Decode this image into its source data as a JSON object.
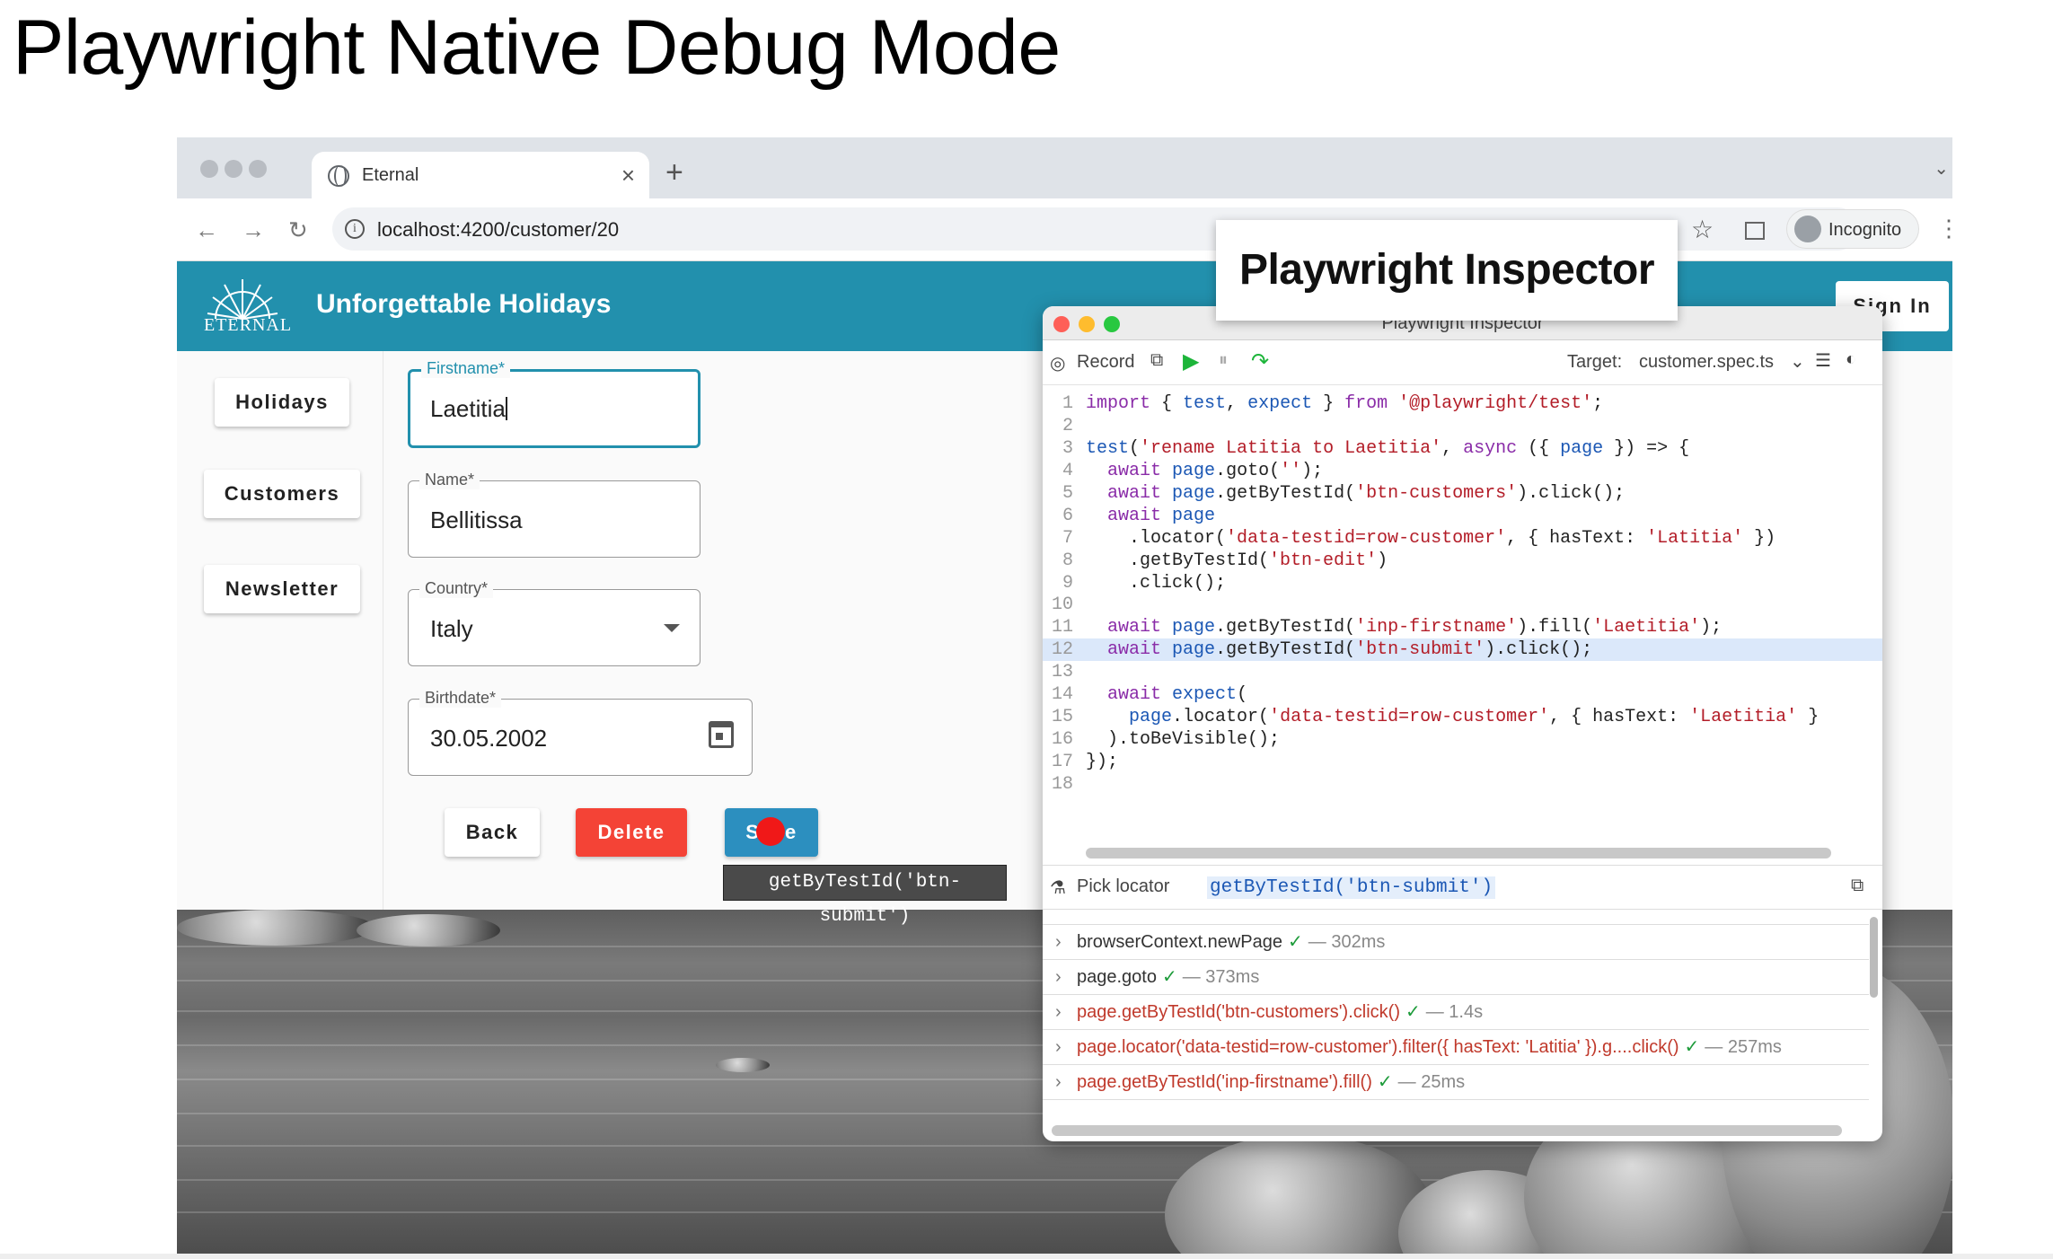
{
  "slide": {
    "title": "Playwright Native Debug Mode"
  },
  "browser": {
    "tab_title": "Eternal",
    "url": "localhost:4200/customer/20",
    "profile_label": "Incognito"
  },
  "app": {
    "logo_text": "ETERNAL",
    "title": "Unforgettable Holidays",
    "sign_in": "Sign In",
    "nav": [
      "Holidays",
      "Customers",
      "Newsletter"
    ],
    "form": {
      "firstname": {
        "label": "Firstname*",
        "value": "Laetitia"
      },
      "name": {
        "label": "Name*",
        "value": "Bellitissa"
      },
      "country": {
        "label": "Country*",
        "value": "Italy"
      },
      "birthdate": {
        "label": "Birthdate*",
        "value": "30.05.2002"
      }
    },
    "buttons": {
      "back": "Back",
      "delete": "Delete",
      "save": "Save"
    },
    "tooltip": "getByTestId('btn-submit')"
  },
  "inspector": {
    "window_title": "Playwright Inspector",
    "record_label": "Record",
    "target_label": "Target:",
    "target_value": "customer.spec.ts",
    "pick_locator_label": "Pick locator",
    "pick_locator_value": "getByTestId('btn-submit')",
    "code_lines": [
      "import { test, expect } from '@playwright/test';",
      "",
      "test('rename Latitia to Laetitia', async ({ page }) => {",
      "  await page.goto('');",
      "  await page.getByTestId('btn-customers').click();",
      "  await page",
      "    .locator('data-testid=row-customer', { hasText: 'Latitia' })",
      "    .getByTestId('btn-edit')",
      "    .click();",
      "",
      "  await page.getByTestId('inp-firstname').fill('Laetitia');",
      "  await page.getByTestId('btn-submit').click();",
      "",
      "  await expect(",
      "    page.locator('data-testid=row-customer', { hasText: 'Laetitia' }",
      "  ).toBeVisible();",
      "});",
      ""
    ],
    "highlighted_line": 12,
    "call_log": [
      {
        "text": "browserContext.newPage",
        "duration": "— 302ms",
        "error": false
      },
      {
        "text": "page.goto",
        "duration": "— 373ms",
        "error": false
      },
      {
        "text": "page.getByTestId('btn-customers').click()",
        "duration": "— 1.4s",
        "error": true
      },
      {
        "text": "page.locator('data-testid=row-customer').filter({ hasText: 'Latitia' }).g....click()",
        "duration": "— 257ms",
        "error": true
      },
      {
        "text": "page.getByTestId('inp-firstname').fill()",
        "duration": "— 25ms",
        "error": true
      }
    ]
  },
  "callout": {
    "text": "Playwright Inspector"
  },
  "colors": {
    "app_header": "#2290ad",
    "delete_button": "#f44336",
    "save_button": "#2c8fbf",
    "record_dot": "#f01818"
  }
}
